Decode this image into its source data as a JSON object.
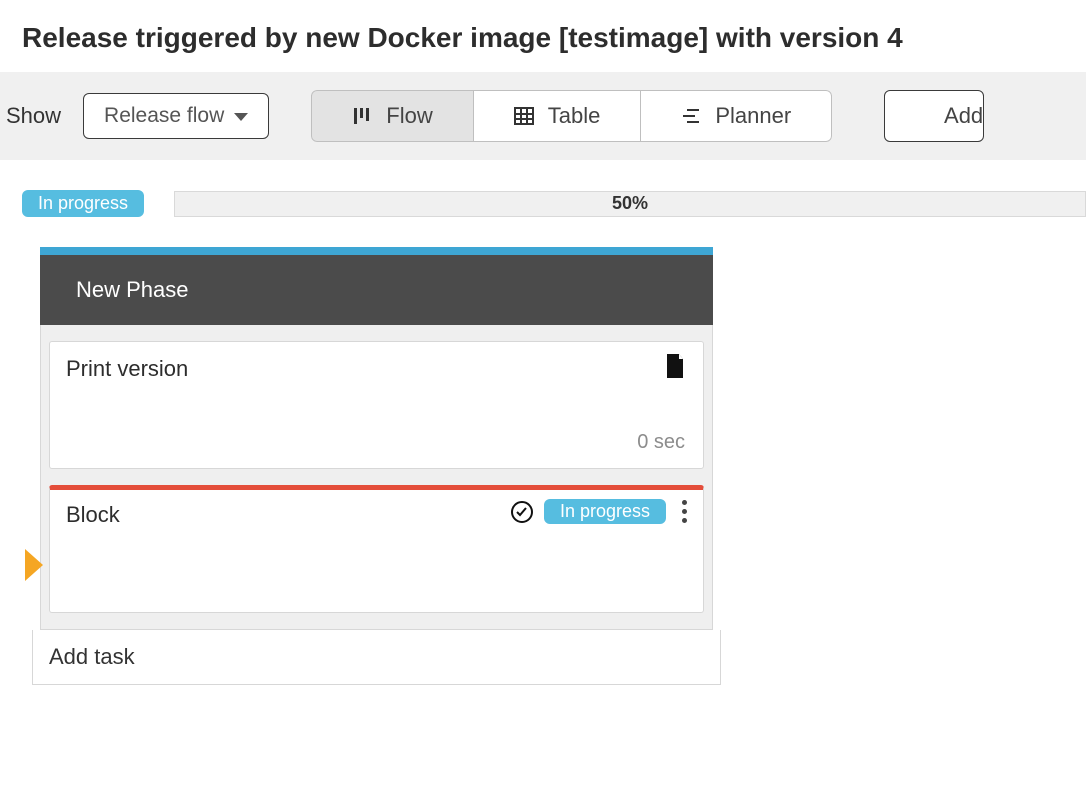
{
  "title": "Release triggered by new Docker image [testimage] with version 4",
  "toolbar": {
    "show_label": "Show",
    "dropdown_label": "Release flow",
    "views": {
      "flow": "Flow",
      "table": "Table",
      "planner": "Planner"
    },
    "add_label": "Add"
  },
  "status": {
    "pill_text": "In progress",
    "percent_text": "50%"
  },
  "phase": {
    "name": "New Phase",
    "tasks": [
      {
        "title": "Print version",
        "duration": "0 sec"
      },
      {
        "title": "Block",
        "badge": "In progress"
      }
    ],
    "add_task_label": "Add task"
  }
}
